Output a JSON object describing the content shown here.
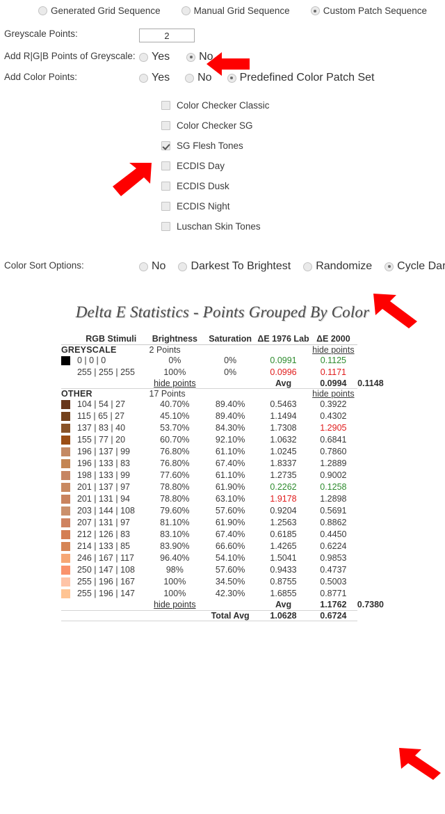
{
  "sequence_options": [
    {
      "label": "Generated Grid Sequence",
      "checked": false
    },
    {
      "label": "Manual Grid Sequence",
      "checked": false
    },
    {
      "label": "Custom Patch Sequence",
      "checked": true
    }
  ],
  "greyscale_points": {
    "label": "Greyscale Points:",
    "value": "2"
  },
  "rgb_points": {
    "label": "Add R|G|B Points of Greyscale:",
    "options": [
      {
        "label": "Yes",
        "checked": false
      },
      {
        "label": "No",
        "checked": true
      }
    ]
  },
  "color_points": {
    "label": "Add Color Points:",
    "options": [
      {
        "label": "Yes",
        "checked": false
      },
      {
        "label": "No",
        "checked": false
      },
      {
        "label": "Predefined Color Patch Set",
        "checked": true
      }
    ]
  },
  "patch_sets": [
    {
      "label": "Color Checker Classic",
      "checked": false
    },
    {
      "label": "Color Checker SG",
      "checked": false
    },
    {
      "label": "SG Flesh Tones",
      "checked": true
    },
    {
      "label": "ECDIS Day",
      "checked": false
    },
    {
      "label": "ECDIS Dusk",
      "checked": false
    },
    {
      "label": "ECDIS Night",
      "checked": false
    },
    {
      "label": "Luschan Skin Tones",
      "checked": false
    }
  ],
  "color_sort": {
    "label": "Color Sort Options:",
    "options": [
      {
        "label": "No",
        "checked": false
      },
      {
        "label": "Darkest To Brightest",
        "checked": false
      },
      {
        "label": "Randomize",
        "checked": false
      },
      {
        "label": "Cycle Dark Bright",
        "checked": true
      }
    ]
  },
  "stats": {
    "title": "Delta E Statistics - Points Grouped By Color",
    "columns": [
      "RGB Stimuli",
      "Brightness",
      "Saturation",
      "ΔE 1976 Lab",
      "ΔE 2000"
    ],
    "hide_points_label": "hide points",
    "avg_label": "Avg",
    "total_label": "Total Avg",
    "groups": [
      {
        "name": "GREYSCALE",
        "count": "2 Points",
        "rows": [
          {
            "swatch": "#000000",
            "rgb": "0 | 0 | 0",
            "brightness": "0%",
            "saturation": "0%",
            "de1976": "0.0991",
            "de1976_color": "green",
            "de2000": "0.1125",
            "de2000_color": "green"
          },
          {
            "swatch": "#ffffff",
            "rgb": "255 | 255 | 255",
            "brightness": "100%",
            "saturation": "0%",
            "de1976": "0.0996",
            "de1976_color": "red",
            "de2000": "0.1171",
            "de2000_color": "red"
          }
        ],
        "avg_de1976": "0.0994",
        "avg_de2000": "0.1148"
      },
      {
        "name": "OTHER",
        "count": "17 Points",
        "rows": [
          {
            "swatch": "#68361b",
            "rgb": "104 | 54 | 27",
            "brightness": "40.70%",
            "saturation": "89.40%",
            "de1976": "0.5463",
            "de1976_color": "",
            "de2000": "0.3922",
            "de2000_color": ""
          },
          {
            "swatch": "#73411b",
            "rgb": "115 | 65 | 27",
            "brightness": "45.10%",
            "saturation": "89.40%",
            "de1976": "1.1494",
            "de1976_color": "",
            "de2000": "0.4302",
            "de2000_color": ""
          },
          {
            "swatch": "#895328",
            "rgb": "137 | 83 | 40",
            "brightness": "53.70%",
            "saturation": "84.30%",
            "de1976": "1.7308",
            "de1976_color": "",
            "de2000": "1.2905",
            "de2000_color": "red"
          },
          {
            "swatch": "#9b4d14",
            "rgb": "155 | 77 | 20",
            "brightness": "60.70%",
            "saturation": "92.10%",
            "de1976": "1.0632",
            "de1976_color": "",
            "de2000": "0.6841",
            "de2000_color": ""
          },
          {
            "swatch": "#c48963",
            "rgb": "196 | 137 | 99",
            "brightness": "76.80%",
            "saturation": "61.10%",
            "de1976": "1.0245",
            "de1976_color": "",
            "de2000": "0.7860",
            "de2000_color": ""
          },
          {
            "swatch": "#c48553",
            "rgb": "196 | 133 | 83",
            "brightness": "76.80%",
            "saturation": "67.40%",
            "de1976": "1.8337",
            "de1976_color": "",
            "de2000": "1.2889",
            "de2000_color": ""
          },
          {
            "swatch": "#c68563",
            "rgb": "198 | 133 | 99",
            "brightness": "77.60%",
            "saturation": "61.10%",
            "de1976": "1.2735",
            "de1976_color": "",
            "de2000": "0.9002",
            "de2000_color": ""
          },
          {
            "swatch": "#c98961",
            "rgb": "201 | 137 | 97",
            "brightness": "78.80%",
            "saturation": "61.90%",
            "de1976": "0.2262",
            "de1976_color": "green",
            "de2000": "0.1258",
            "de2000_color": "green"
          },
          {
            "swatch": "#c9835e",
            "rgb": "201 | 131 | 94",
            "brightness": "78.80%",
            "saturation": "63.10%",
            "de1976": "1.9178",
            "de1976_color": "red",
            "de2000": "1.2898",
            "de2000_color": ""
          },
          {
            "swatch": "#cb906c",
            "rgb": "203 | 144 | 108",
            "brightness": "79.60%",
            "saturation": "57.60%",
            "de1976": "0.9204",
            "de1976_color": "",
            "de2000": "0.5691",
            "de2000_color": ""
          },
          {
            "swatch": "#cf8361",
            "rgb": "207 | 131 | 97",
            "brightness": "81.10%",
            "saturation": "61.90%",
            "de1976": "1.2563",
            "de1976_color": "",
            "de2000": "0.8862",
            "de2000_color": ""
          },
          {
            "swatch": "#d47e53",
            "rgb": "212 | 126 | 83",
            "brightness": "83.10%",
            "saturation": "67.40%",
            "de1976": "0.6185",
            "de1976_color": "",
            "de2000": "0.4450",
            "de2000_color": ""
          },
          {
            "swatch": "#d68555",
            "rgb": "214 | 133 | 85",
            "brightness": "83.90%",
            "saturation": "66.60%",
            "de1976": "1.4265",
            "de1976_color": "",
            "de2000": "0.6224",
            "de2000_color": ""
          },
          {
            "swatch": "#f6a775",
            "rgb": "246 | 167 | 117",
            "brightness": "96.40%",
            "saturation": "54.10%",
            "de1976": "1.5041",
            "de1976_color": "",
            "de2000": "0.9853",
            "de2000_color": ""
          },
          {
            "swatch": "#fa936c",
            "rgb": "250 | 147 | 108",
            "brightness": "98%",
            "saturation": "57.60%",
            "de1976": "0.9433",
            "de1976_color": "",
            "de2000": "0.4737",
            "de2000_color": ""
          },
          {
            "swatch": "#ffc4a7",
            "rgb": "255 | 196 | 167",
            "brightness": "100%",
            "saturation": "34.50%",
            "de1976": "0.8755",
            "de1976_color": "",
            "de2000": "0.5003",
            "de2000_color": ""
          },
          {
            "swatch": "#ffc493",
            "rgb": "255 | 196 | 147",
            "brightness": "100%",
            "saturation": "42.30%",
            "de1976": "1.6855",
            "de1976_color": "",
            "de2000": "0.8771",
            "de2000_color": ""
          }
        ],
        "avg_de1976": "1.1762",
        "avg_de2000": "0.7380"
      }
    ],
    "total_de1976": "1.0628",
    "total_de2000": "0.6724"
  },
  "annotations": {
    "arrow_color": "#fe0000",
    "arrows": [
      {
        "name": "arrow-pointing-no-radio",
        "direction": "left"
      },
      {
        "name": "arrow-pointing-sg-flesh-tones",
        "direction": "up-right"
      },
      {
        "name": "arrow-pointing-cycle-dark-bright",
        "direction": "up-left"
      },
      {
        "name": "arrow-pointing-other-avg-de2000",
        "direction": "up-left"
      }
    ]
  }
}
